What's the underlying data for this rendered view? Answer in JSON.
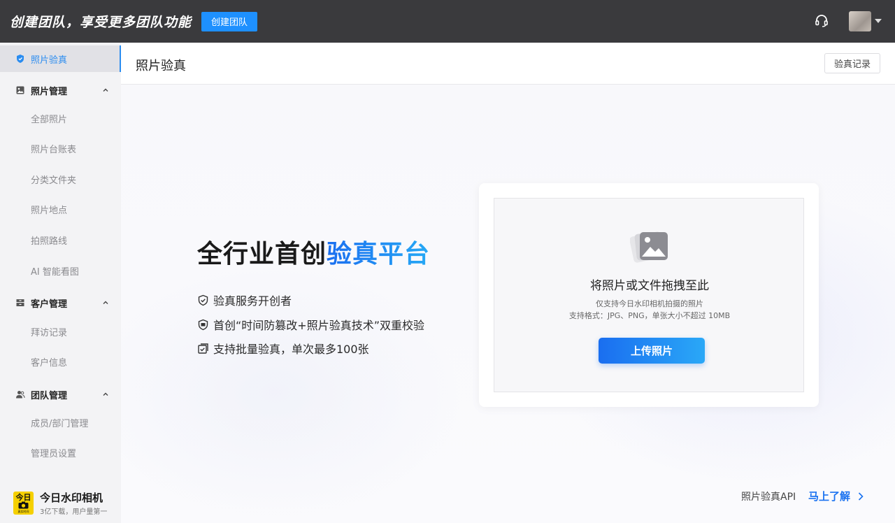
{
  "topbar": {
    "title": "创建团队，享受更多团队功能",
    "create_team_label": "创建团队"
  },
  "sidebar": {
    "active_item": "照片验真",
    "groups": [
      {
        "label": "照片管理",
        "items": [
          "全部照片",
          "照片台账表",
          "分类文件夹",
          "照片地点",
          "拍照路线",
          "AI 智能看图"
        ]
      },
      {
        "label": "客户管理",
        "items": [
          "拜访记录",
          "客户信息"
        ]
      },
      {
        "label": "团队管理",
        "items": [
          "成员/部门管理",
          "管理员设置"
        ]
      }
    ],
    "brand": {
      "logo_text_top": "今日",
      "logo_text_bottom": "真实时间",
      "name": "今日水印相机",
      "subtitle": "3亿下载，用户量第一"
    }
  },
  "page": {
    "title": "照片验真",
    "record_button": "验真记录"
  },
  "hero": {
    "title_plain": "全行业首创",
    "title_accent": "验真平台",
    "features": [
      "验真服务开创者",
      "首创“时间防篡改+照片验真技术”双重校验",
      "支持批量验真，单次最多100张"
    ]
  },
  "upload": {
    "title": "将照片或文件拖拽至此",
    "hint_line1": "仅支持今日水印相机拍摄的照片",
    "hint_line2": "支持格式：JPG、PNG，单张大小不超过 10MB",
    "button": "上传照片"
  },
  "footer": {
    "api_text": "照片验真API",
    "learn_more": "马上了解"
  },
  "colors": {
    "topbar_bg": "#3a3a3d",
    "accent": "#1a72f0",
    "sidebar_bg": "#f3f3f5"
  }
}
